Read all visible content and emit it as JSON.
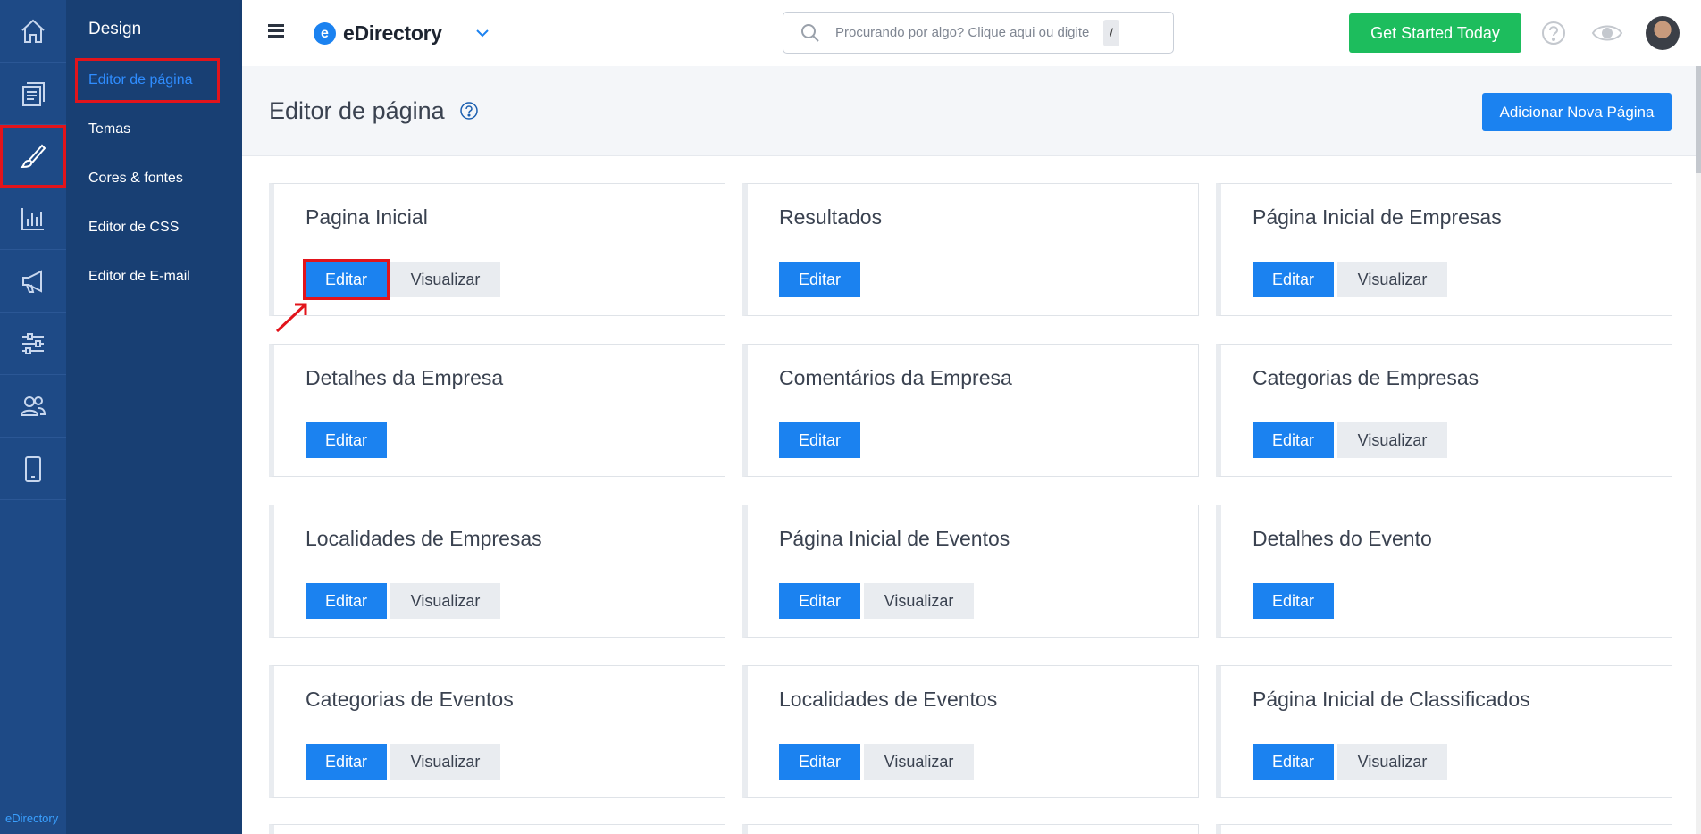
{
  "rail": {
    "items": [
      {
        "name": "home-icon",
        "active": false
      },
      {
        "name": "content-icon",
        "active": false
      },
      {
        "name": "brush-icon",
        "active": true
      },
      {
        "name": "chart-icon",
        "active": false
      },
      {
        "name": "megaphone-icon",
        "active": false
      },
      {
        "name": "sliders-icon",
        "active": false
      },
      {
        "name": "users-icon",
        "active": false
      },
      {
        "name": "mobile-icon",
        "active": false
      }
    ],
    "brand": "eDirectory"
  },
  "submenu": {
    "title": "Design",
    "items": [
      {
        "label": "Editor de página",
        "active": true
      },
      {
        "label": "Temas",
        "active": false
      },
      {
        "label": "Cores & fontes",
        "active": false
      },
      {
        "label": "Editor de CSS",
        "active": false
      },
      {
        "label": "Editor de E-mail",
        "active": false
      }
    ]
  },
  "header": {
    "logo_letter": "e",
    "logo_text": "eDirectory",
    "search_placeholder": "Procurando por algo? Clique aqui ou digite",
    "search_shortcut": "/",
    "cta_label": "Get Started Today"
  },
  "page": {
    "title": "Editor de página",
    "add_button": "Adicionar Nova Página"
  },
  "buttons": {
    "edit": "Editar",
    "view": "Visualizar"
  },
  "cards": [
    {
      "title": "Pagina Inicial",
      "view": true
    },
    {
      "title": "Resultados",
      "view": false
    },
    {
      "title": "Página Inicial de Empresas",
      "view": true
    },
    {
      "title": "Detalhes da Empresa",
      "view": false
    },
    {
      "title": "Comentários da Empresa",
      "view": false
    },
    {
      "title": "Categorias de Empresas",
      "view": true
    },
    {
      "title": "Localidades de Empresas",
      "view": true
    },
    {
      "title": "Página Inicial de Eventos",
      "view": true
    },
    {
      "title": "Detalhes do Evento",
      "view": false
    },
    {
      "title": "Categorias de Eventos",
      "view": true
    },
    {
      "title": "Localidades de Eventos",
      "view": true
    },
    {
      "title": "Página Inicial de Classificados",
      "view": true
    }
  ],
  "colors": {
    "rail": "#1e4a86",
    "submenu": "#183f73",
    "primary": "#1b82f0",
    "success": "#1dbd5d",
    "highlight": "#e2141b"
  }
}
